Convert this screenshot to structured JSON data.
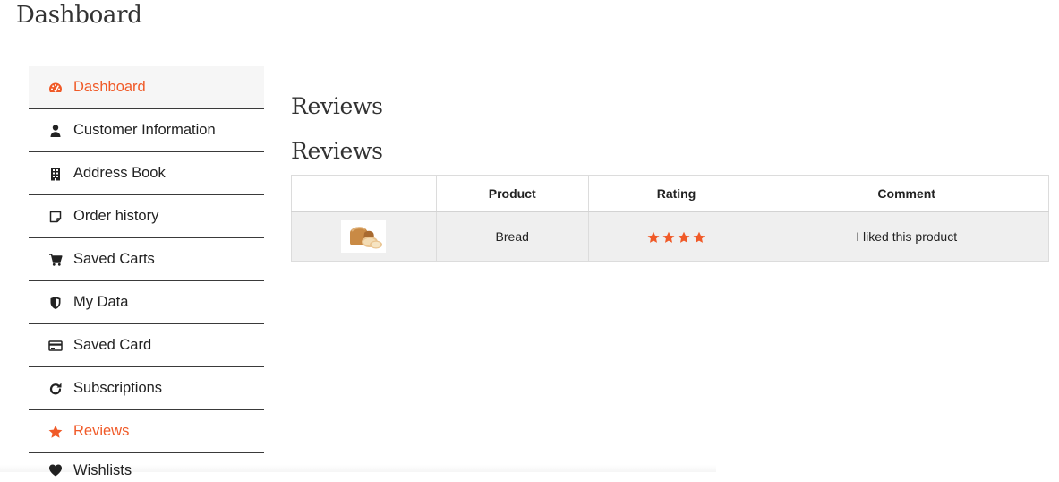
{
  "page": {
    "title": "Dashboard"
  },
  "sidebar": {
    "items": [
      {
        "label": "Dashboard",
        "icon": "dashboard-icon",
        "active": true
      },
      {
        "label": "Customer Information",
        "icon": "user-icon"
      },
      {
        "label": "Address Book",
        "icon": "building-icon"
      },
      {
        "label": "Order history",
        "icon": "note-icon"
      },
      {
        "label": "Saved Carts",
        "icon": "cart-icon"
      },
      {
        "label": "My Data",
        "icon": "shield-icon"
      },
      {
        "label": "Saved Card",
        "icon": "credit-card-icon"
      },
      {
        "label": "Subscriptions",
        "icon": "refresh-icon"
      },
      {
        "label": "Reviews",
        "icon": "star-icon",
        "highlighted": true
      },
      {
        "label": "Wishlists",
        "icon": "heart-icon"
      }
    ]
  },
  "main": {
    "heading": "Reviews",
    "subheading": "Reviews",
    "table": {
      "columns": [
        "",
        "Product",
        "Rating",
        "Comment"
      ],
      "rows": [
        {
          "image": "bread-thumbnail",
          "product": "Bread",
          "rating": 4,
          "comment": "I liked this product"
        }
      ]
    }
  },
  "colors": {
    "accent": "#f05a28",
    "row_bg": "#efefef",
    "active_bg": "#f6f6f6"
  }
}
